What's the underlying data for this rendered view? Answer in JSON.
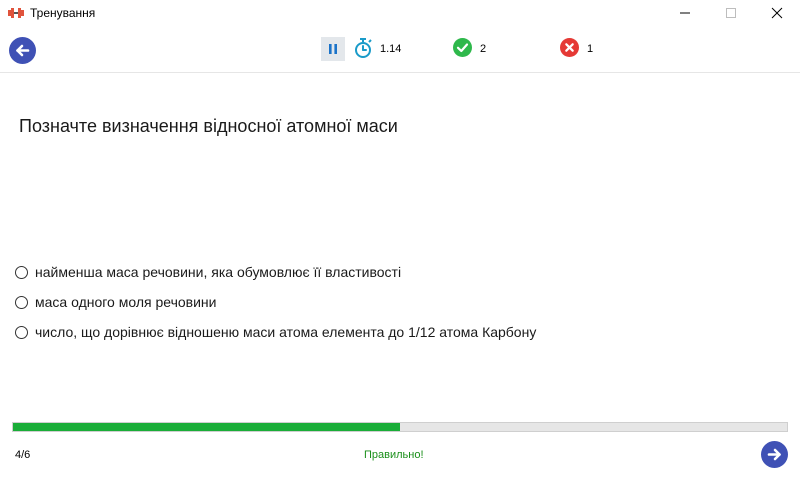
{
  "window": {
    "title": "Тренування",
    "icon": "dumbbell-icon"
  },
  "toolbar": {
    "back_icon": "arrow-left-icon",
    "pause_icon": "pause-icon",
    "timer_icon": "stopwatch-icon",
    "timer_value": "1.14",
    "correct_icon": "check-circle-icon",
    "correct_count": "2",
    "wrong_icon": "x-circle-icon",
    "wrong_count": "1"
  },
  "question": {
    "text": "Позначте визначення відносної атомної маси",
    "answers": [
      {
        "label": "найменша маса речовини, яка обумовлює її властивості",
        "selected": false
      },
      {
        "label": "маса одного моля речовини",
        "selected": false
      },
      {
        "label": "число, що дорівнює відношеню маси атома елемента до 1/12 атома Карбону",
        "selected": false
      }
    ]
  },
  "footer": {
    "progress_fraction": 0.5,
    "counter": "4/6",
    "status": "Правильно!",
    "next_icon": "arrow-right-icon"
  },
  "colors": {
    "accent": "#3f51b5",
    "progress": "#1aad38",
    "correct": "#2eb84b",
    "wrong": "#e53935",
    "timer": "#1a9bc9",
    "status_text": "#1a8f1a"
  }
}
